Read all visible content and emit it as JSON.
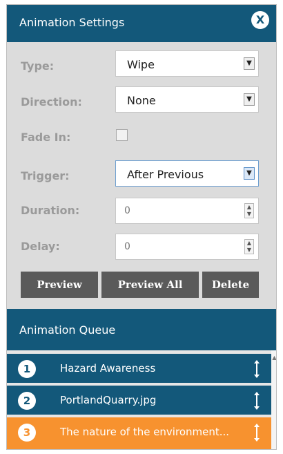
{
  "header": {
    "title": "Animation Settings",
    "close_label": "X"
  },
  "form": {
    "type": {
      "label": "Type:",
      "value": "Wipe"
    },
    "direction": {
      "label": "Direction:",
      "value": "None"
    },
    "fade_in": {
      "label": "Fade In:",
      "checked": false
    },
    "trigger": {
      "label": "Trigger:",
      "value": "After Previous"
    },
    "duration": {
      "label": "Duration:",
      "value": "0"
    },
    "delay": {
      "label": "Delay:",
      "value": "0"
    }
  },
  "actions": {
    "preview": "Preview",
    "preview_all": "Preview All",
    "delete": "Delete"
  },
  "queue": {
    "title": "Animation Queue",
    "items": [
      {
        "number": "1",
        "label": "Hazard Awareness",
        "selected": false
      },
      {
        "number": "2",
        "label": "PortlandQuarry.jpg",
        "selected": false
      },
      {
        "number": "3",
        "label": "The nature of the environment...",
        "selected": true
      }
    ]
  },
  "colors": {
    "header": "#13587a",
    "selected": "#f7922f",
    "button": "#5a5a5a"
  },
  "icons": {
    "close": "close-icon",
    "drag": "drag-handle-icon",
    "dropdown": "chevron-down-icon",
    "spinner": "spinner-icon"
  }
}
